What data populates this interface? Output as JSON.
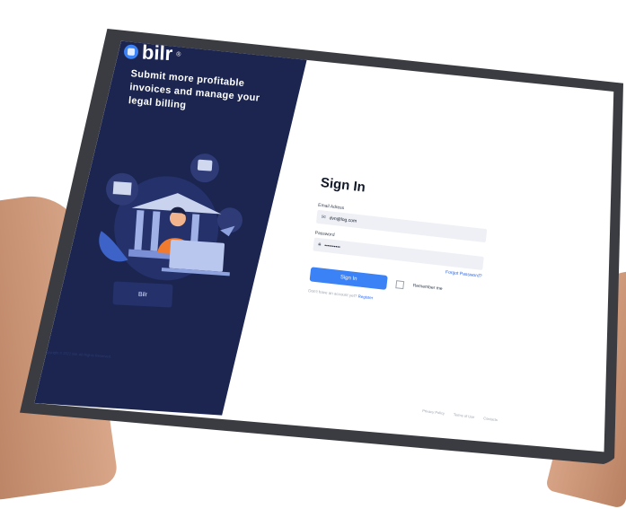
{
  "brand": {
    "name": "bilr",
    "reg_mark": "®"
  },
  "tagline": "Submit more profitable invoices and manage your legal billing",
  "left_panel": {
    "app_button_label": "Bilr",
    "copyright": "Copyright © 2022 Bilr. All Rights Reserved."
  },
  "form": {
    "title": "Sign In",
    "email_label": "Email Adress",
    "email_value": "dvn@log.com",
    "password_label": "Password",
    "password_value": "••••••••••",
    "forgot_label": "Forgot Password?",
    "signin_label": "Sign In",
    "remember_label": "Remember me",
    "no_account_text": "Don't have an account yet?",
    "register_label": "Register"
  },
  "footer": {
    "privacy": "Privacy Policy",
    "terms": "Terms of Use",
    "contacts": "Contacts"
  },
  "icons": {
    "email": "mail-icon",
    "password": "lock-icon"
  },
  "colors": {
    "panel_bg": "#1b2550",
    "accent": "#3b82f6",
    "link": "#2563eb"
  }
}
